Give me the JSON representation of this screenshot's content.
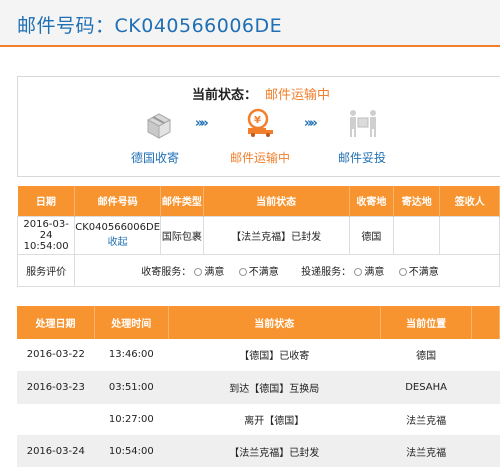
{
  "header": {
    "title": "邮件号码：CK040566006DE"
  },
  "status": {
    "label": "当前状态：",
    "value": "邮件运输中",
    "steps": [
      {
        "label": "德国收寄",
        "icon": "box-icon",
        "state": "done"
      },
      {
        "label": "邮件运输中",
        "icon": "delivery-truck-icon",
        "state": "active"
      },
      {
        "label": "邮件妥投",
        "icon": "handover-icon",
        "state": "pending"
      }
    ],
    "arrow": "»»"
  },
  "summary": {
    "headers": [
      "日期",
      "邮件号码",
      "邮件类型",
      "当前状态",
      "收寄地",
      "寄达地",
      "签收人"
    ],
    "row": {
      "date": "2016-03-24 10:54:00",
      "number": "CK040566006DE",
      "toggle": "收起",
      "type": "国际包裹",
      "status": "【法兰克福】已封发",
      "origin": "德国",
      "destination": "",
      "signer": ""
    },
    "evaluation": {
      "label": "服务评价",
      "collect_label": "收寄服务：",
      "deliver_label": "投递服务：",
      "satisfied": "满意",
      "unsatisfied": "不满意"
    }
  },
  "tracking": {
    "headers": [
      "处理日期",
      "处理时间",
      "当前状态",
      "当前位置"
    ],
    "rows": [
      {
        "date": "2016-03-22",
        "time": "13:46:00",
        "status": "【德国】已收寄",
        "location": "德国"
      },
      {
        "date": "2016-03-23",
        "time": "03:51:00",
        "status": "到达【德国】互换局",
        "location": "DESAHA"
      },
      {
        "date": "",
        "time": "10:27:00",
        "status": "离开【德国】",
        "location": "法兰克福"
      },
      {
        "date": "2016-03-24",
        "time": "10:54:00",
        "status": "【法兰克福】已封发",
        "location": "法兰克福"
      }
    ]
  },
  "colors": {
    "accent": "#f8942f",
    "link": "#1f6fb4",
    "active": "#f17f2c"
  }
}
